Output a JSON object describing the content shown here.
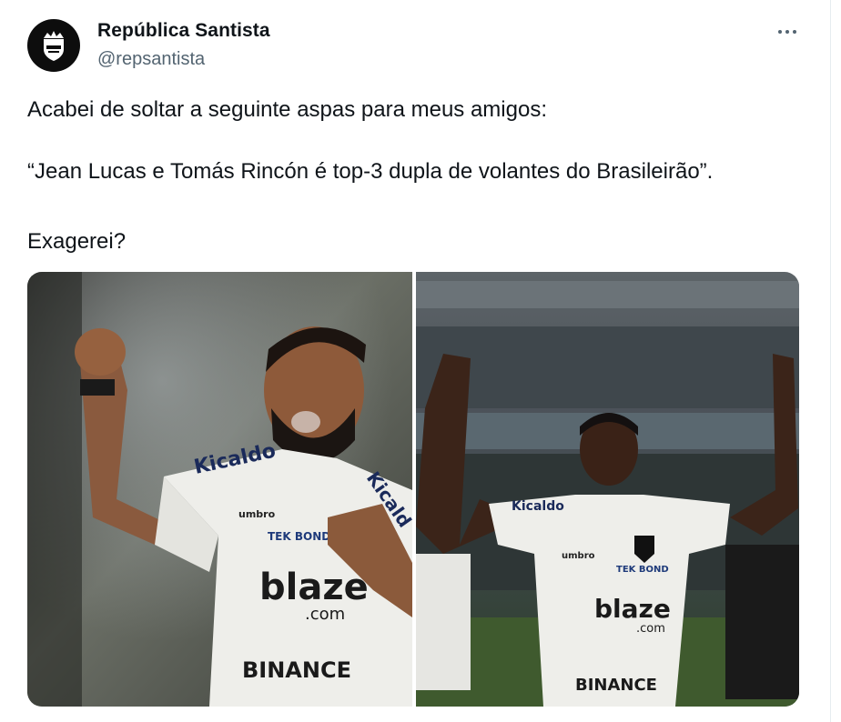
{
  "author": {
    "display_name": "República Santista",
    "handle": "@repsantista",
    "avatar_icon": "shield-crown-logo"
  },
  "more_icon": "ellipsis-icon",
  "tweet": {
    "line_1": "Acabei de soltar a seguinte aspas para meus amigos:",
    "line_2": "“Jean Lucas e Tomás Rincón é top-3 dupla de volantes do Brasileirão”.",
    "line_3": "Exagerei?"
  },
  "media": {
    "left_photo": {
      "jersey_text_1": "Kicaldo",
      "jersey_text_2": "Kicald",
      "kit_brand": "umbro",
      "sponsor_1": "TEK BOND",
      "sponsor_2": "blaze",
      "sponsor_2_suffix": ".com",
      "sponsor_3": "BINANCE"
    },
    "right_photo": {
      "jersey_text": "Kicaldo",
      "kit_brand": "umbro",
      "sponsor_1": "TEK BOND",
      "sponsor_2": "blaze",
      "sponsor_2_suffix": ".com",
      "sponsor_3": "BINANCE"
    }
  },
  "colors": {
    "text_primary": "#0f1419",
    "text_secondary": "#536471",
    "avatar_bg": "#0d0d0d"
  }
}
